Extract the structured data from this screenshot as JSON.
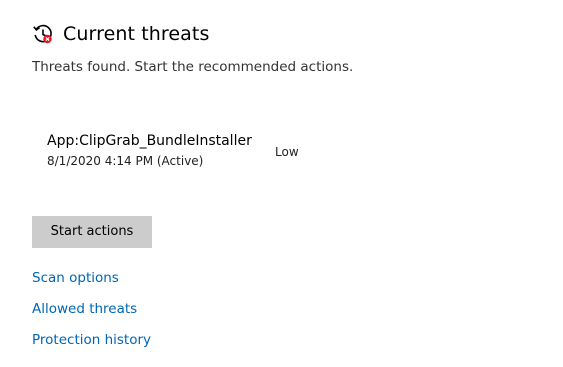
{
  "header": {
    "title": "Current threats",
    "icon": "history-clock-alert-icon"
  },
  "subtitle": "Threats found. Start the recommended actions.",
  "threats": [
    {
      "name": "App:ClipGrab_BundleInstaller",
      "date": "8/1/2020 4:14 PM (Active)",
      "severity": "Low"
    }
  ],
  "actions": {
    "start_label": "Start actions"
  },
  "links": {
    "scan_options": "Scan options",
    "allowed_threats": "Allowed threats",
    "protection_history": "Protection history"
  },
  "colors": {
    "link": "#0066b4",
    "button_bg": "#cccccc",
    "alert_badge": "#e81123"
  }
}
